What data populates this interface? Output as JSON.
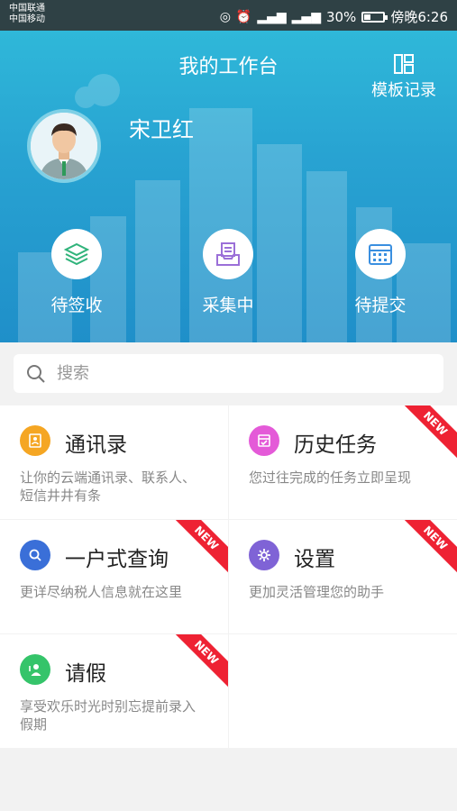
{
  "status_bar": {
    "carrier1": "中国联通",
    "carrier2": "中国移动",
    "battery": "30%",
    "battery_level": 0.3,
    "time": "傍晚6:26"
  },
  "header": {
    "title": "我的工作台",
    "template_label": "模板记录",
    "user_name": "宋卫红"
  },
  "quick_actions": [
    {
      "label": "待签收",
      "icon": "layers-icon"
    },
    {
      "label": "采集中",
      "icon": "inbox-icon"
    },
    {
      "label": "待提交",
      "icon": "calendar-icon"
    }
  ],
  "search": {
    "placeholder": "搜索"
  },
  "cards": [
    {
      "title": "通讯录",
      "desc": "让你的云端通讯录、联系人、短信井井有条",
      "color": "#f5a623",
      "badge": ""
    },
    {
      "title": "历史任务",
      "desc": "您过往完成的任务立即呈现",
      "color": "#e45ad8",
      "badge": "NEW"
    },
    {
      "title": "一户式查询",
      "desc": "更详尽纳税人信息就在这里",
      "color": "#3a6fd8",
      "badge": "NEW"
    },
    {
      "title": "设置",
      "desc": "更加灵活管理您的助手",
      "color": "#7f63d6",
      "badge": "NEW"
    },
    {
      "title": "请假",
      "desc": "享受欢乐时光时别忘提前录入假期",
      "color": "#35c46a",
      "badge": "NEW"
    }
  ]
}
